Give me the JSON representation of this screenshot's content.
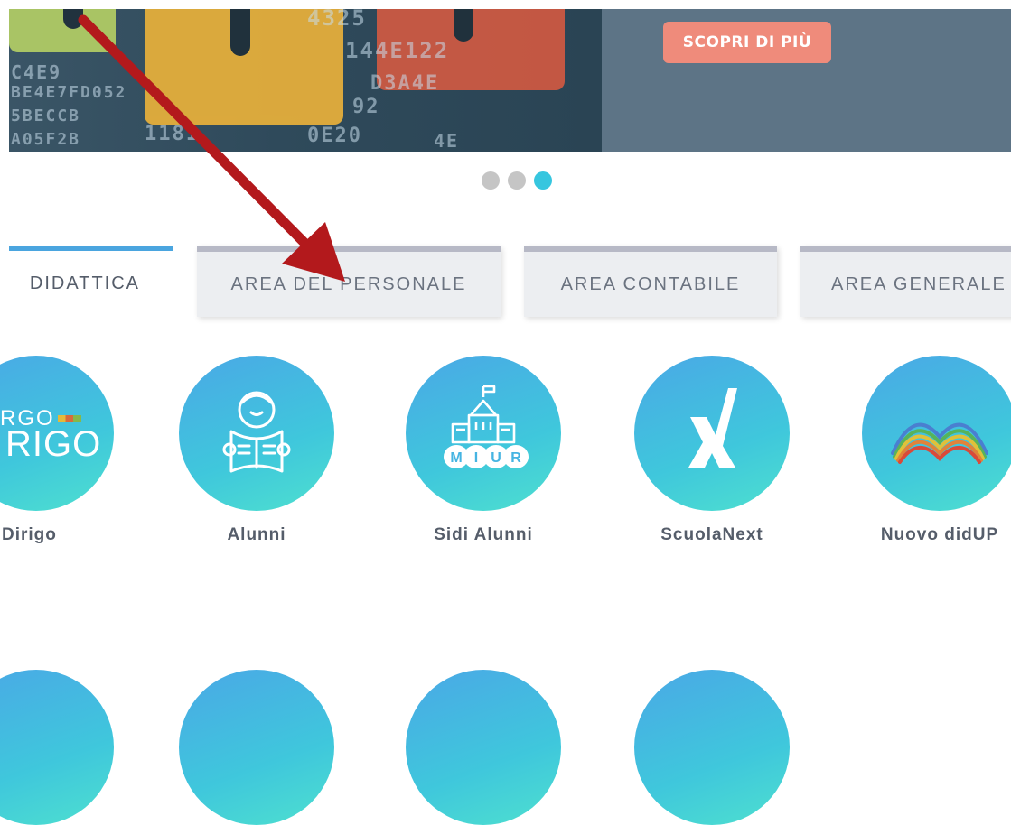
{
  "hero": {
    "cta_label": "SCOPRI DI PIÙ",
    "hex_lines": [
      "4325",
      "C4E9",
      "144E122",
      "BE4E7FD052",
      "D3A4E",
      "5BECCB",
      "92",
      "A05F2B",
      "1181",
      "0E20",
      "4E"
    ],
    "colors": {
      "panel": "#5d7486",
      "cta": "#ef8b7b"
    }
  },
  "carousel": {
    "active_index": 2,
    "count": 3
  },
  "tabs": [
    {
      "label": "AREA DIDATTICA",
      "visible_label": " DIDATTICA",
      "active": true
    },
    {
      "label": "AREA DEL PERSONALE",
      "active": false
    },
    {
      "label": "AREA CONTABILE",
      "active": false
    },
    {
      "label": "AREA GENERALE",
      "active": false
    }
  ],
  "apps": [
    {
      "label": "Dirigo",
      "visible_label": "Dirigo",
      "icon": "argo-dirigo-logo",
      "logo_text_top": "RGO",
      "logo_text_main": "RIGO"
    },
    {
      "label": "Alunni",
      "icon": "student-reading-icon"
    },
    {
      "label": "Sidi Alunni",
      "icon": "miur-school-icon",
      "logo_text": "MIUR"
    },
    {
      "label": "ScuolaNext",
      "icon": "scuolanext-x-icon"
    },
    {
      "label": "Nuovo didUP",
      "icon": "rainbow-book-icon"
    }
  ],
  "colors": {
    "accent": "#36c6df",
    "tab_active_border": "#4aa5df",
    "arrow": "#b3191c"
  }
}
